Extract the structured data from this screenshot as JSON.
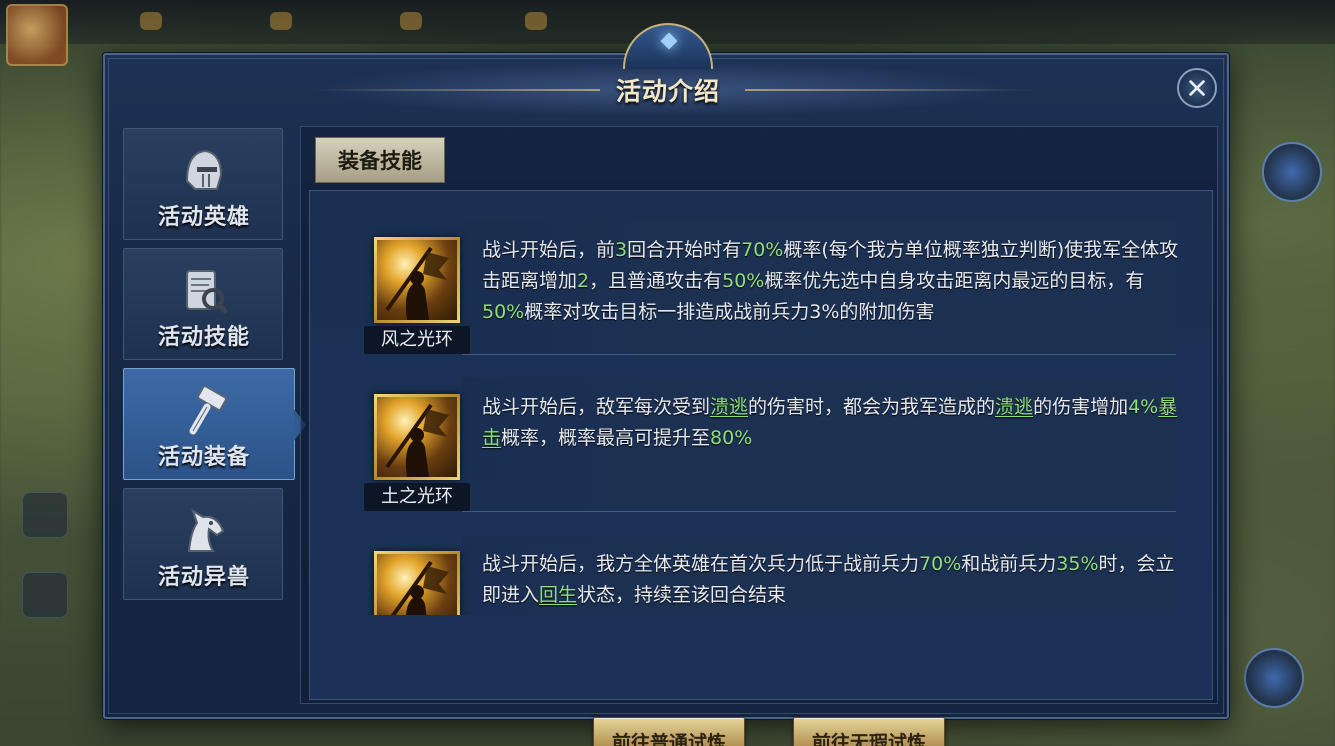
{
  "dialog": {
    "title": "活动介绍"
  },
  "tabs": [
    {
      "label": "活动英雄",
      "icon": "helmet-icon",
      "active": false
    },
    {
      "label": "活动技能",
      "icon": "scroll-magnifier-icon",
      "active": false
    },
    {
      "label": "活动装备",
      "icon": "hammer-icon",
      "active": true
    },
    {
      "label": "活动异兽",
      "icon": "horse-head-icon",
      "active": false
    }
  ],
  "section": {
    "label": "装备技能"
  },
  "skills": [
    {
      "name": "风之光环",
      "icon": "warrior-banner-icon",
      "description": [
        {
          "t": "战斗开始后，前"
        },
        {
          "t": "3",
          "c": "g"
        },
        {
          "t": "回合开始时有"
        },
        {
          "t": "70%",
          "c": "g"
        },
        {
          "t": "概率(每个我方单位概率独立判断)使我军全体攻击距离增加"
        },
        {
          "t": "2",
          "c": "g"
        },
        {
          "t": "，且普通攻击有"
        },
        {
          "t": "50%",
          "c": "g"
        },
        {
          "t": "概率优先选中自身攻击距离内最远的目标，有"
        },
        {
          "t": "50%",
          "c": "g"
        },
        {
          "t": "概率对攻击目标一排造成战前兵力3%的附加伤害"
        }
      ]
    },
    {
      "name": "土之光环",
      "icon": "warrior-banner-icon",
      "description": [
        {
          "t": "战斗开始后，敌军每次受到"
        },
        {
          "t": "溃逃",
          "c": "gu"
        },
        {
          "t": "的伤害时，都会为我军造成的"
        },
        {
          "t": "溃逃",
          "c": "gu"
        },
        {
          "t": "的伤害增加"
        },
        {
          "t": "4%",
          "c": "g"
        },
        {
          "t": "暴击",
          "c": "gu"
        },
        {
          "t": "概率，概率最高可提升至"
        },
        {
          "t": "80%",
          "c": "g"
        }
      ]
    },
    {
      "name": "",
      "icon": "warrior-banner-icon",
      "description": [
        {
          "t": "战斗开始后，我方全体英雄在首次兵力低于战前兵力"
        },
        {
          "t": "70%",
          "c": "g"
        },
        {
          "t": "和战前兵力"
        },
        {
          "t": "35%",
          "c": "g"
        },
        {
          "t": "时，会立即进入"
        },
        {
          "t": "回生",
          "c": "gu"
        },
        {
          "t": "状态，持续至该回合结束"
        }
      ]
    }
  ],
  "buttons": {
    "normal_trial": "前往普通试炼",
    "flawless_trial": "前往无瑕试炼"
  },
  "colors": {
    "highlight_green": "#8fe07a",
    "dialog_blue": "#1d3155",
    "gold_button": "#b8985a"
  }
}
